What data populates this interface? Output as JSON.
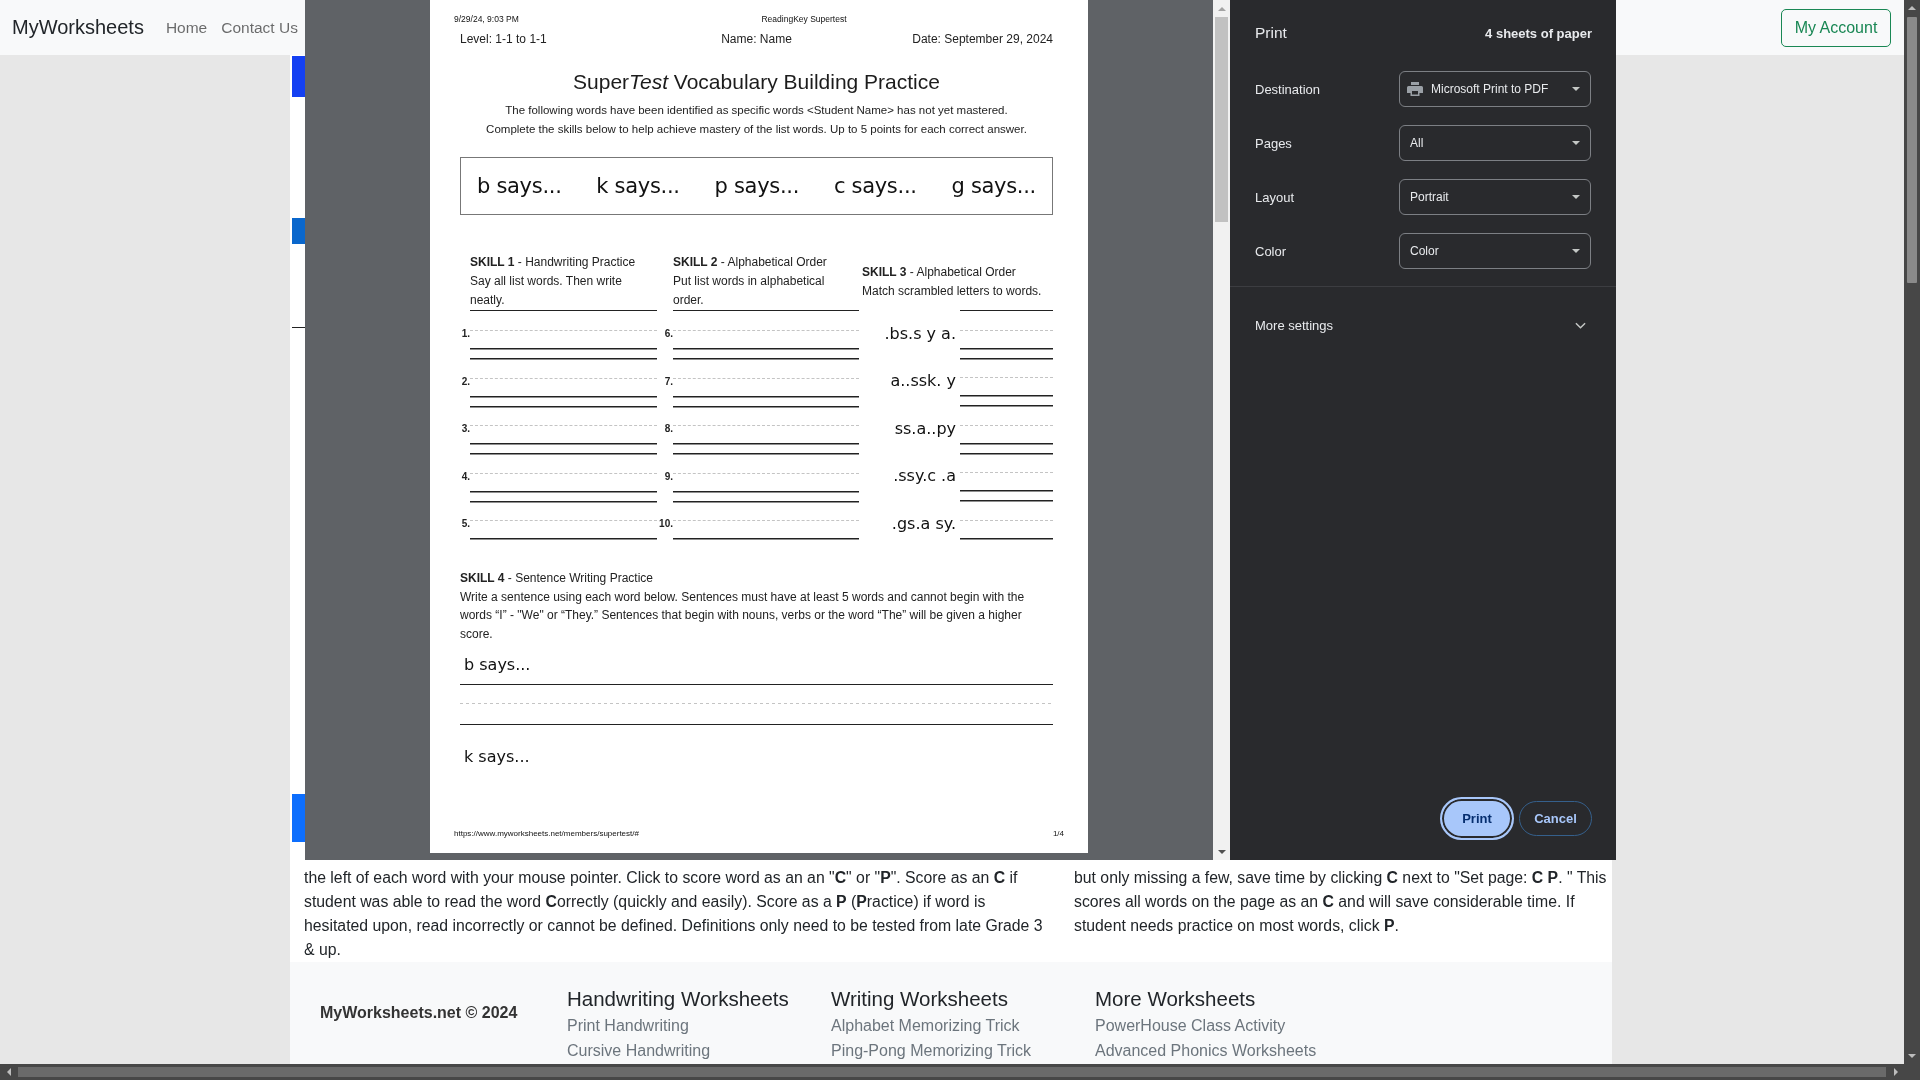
{
  "navbar": {
    "brand": "MyWorksheets",
    "links": [
      {
        "label": "Home"
      },
      {
        "label": "Contact Us"
      }
    ],
    "account_button": "My Account"
  },
  "print_dialog": {
    "preview": {
      "worksheet": {
        "print_header": {
          "date_time": "9/29/24, 9:03 PM",
          "doc_title": "ReadingKey Supertest"
        },
        "meta": [
          "Level: 1-1 to 1-1",
          "Name: Name",
          "Date: September 29, 2024"
        ],
        "title": [
          {
            "text": "Super",
            "italic": false
          },
          {
            "text": "Test",
            "italic": true
          },
          {
            "text": " Vocabulary Building Practice",
            "italic": false
          }
        ],
        "intro_lines": [
          "The following words have been identified as specific words <Student Name> has not yet mastered.",
          "Complete the skills below to help achieve mastery of the list words. Up to 5 points for each correct answer."
        ],
        "word_box": [
          "b says...",
          "k says...",
          "p says...",
          "c says...",
          "g says..."
        ],
        "skills": [
          {
            "kind": "numbered",
            "heading": "**SKILL 1** - Handwriting Practice",
            "instruction": "Say all list words. Then write neatly.",
            "items": [
              "1.",
              "2.",
              "3.",
              "4.",
              "5."
            ]
          },
          {
            "kind": "numbered",
            "heading": "**SKILL 2** - Alphabetical Order",
            "instruction": "Put list words in alphabetical order.",
            "items": [
              "6.",
              "7.",
              "8.",
              "9.",
              "10."
            ]
          },
          {
            "kind": "scrambled",
            "heading": "**SKILL 3** - Alphabetical Order",
            "instruction": "Match scrambled letters to words.",
            "items": [
              ".bs.s y a.",
              "a..ssk. y",
              "ss.a..py",
              ".ssy.c .a",
              ".gs.a sy."
            ]
          }
        ],
        "sentence_skill": {
          "heading": "**SKILL 4** - Sentence Writing Practice",
          "instruction": "Write a sentence using each word below. Sentences must have at least 5 words and cannot begin with the words “I” - \"We\" or “They.” Sentences that begin with nouns, verbs or the word “The” will be given a higher score.",
          "prompts": [
            "b says...",
            "k says..."
          ]
        },
        "print_footer": {
          "url": "https://www.myworksheets.net/members/supertest/#",
          "page_number": "1/4"
        }
      }
    },
    "settings": {
      "title": "Print",
      "sheet_count": "4 sheets of paper",
      "fields": [
        {
          "label": "Destination",
          "value": "Microsoft Print to PDF",
          "kind": "printer"
        },
        {
          "label": "Pages",
          "value": "All",
          "kind": "select"
        },
        {
          "label": "Layout",
          "value": "Portrait",
          "kind": "select"
        },
        {
          "label": "Color",
          "value": "Color",
          "kind": "select"
        }
      ],
      "more_settings": {
        "label": "More settings",
        "expanded": false
      },
      "buttons": [
        {
          "label": "Print",
          "kind": "primary",
          "focused": true
        },
        {
          "label": "Cancel",
          "kind": "secondary",
          "focused": false
        }
      ]
    }
  },
  "page": {
    "instructions": [
      "the left of each word with your mouse pointer. Click to score word as an an \"**C**\" or \"**P**\". Score as an **C** if student was able to read the word **C**orrectly (quickly and easily). Score as a **P** (**P**ractice) if word is hesitated upon, read incorrectly or cannot be defined. Definitions only need to be tested from late Grade 3 & up.",
      "but only missing a few, save time by clicking **C** next to \"Set page: **C P**. \" This scores all words on the page as an **C** and will save considerable time. If student needs practice on most words, click **P**."
    ]
  },
  "footer": {
    "copyright": "MyWorksheets.net © 2024",
    "columns": [
      {
        "heading": "Handwriting Worksheets",
        "links": [
          "Print Handwriting",
          "Cursive Handwriting"
        ]
      },
      {
        "heading": "Writing Worksheets",
        "links": [
          "Alphabet Memorizing Trick",
          "Ping-Pong Memorizing Trick"
        ]
      },
      {
        "heading": "More Worksheets",
        "links": [
          "PowerHouse Class Activity",
          "Advanced Phonics Worksheets"
        ]
      }
    ]
  }
}
